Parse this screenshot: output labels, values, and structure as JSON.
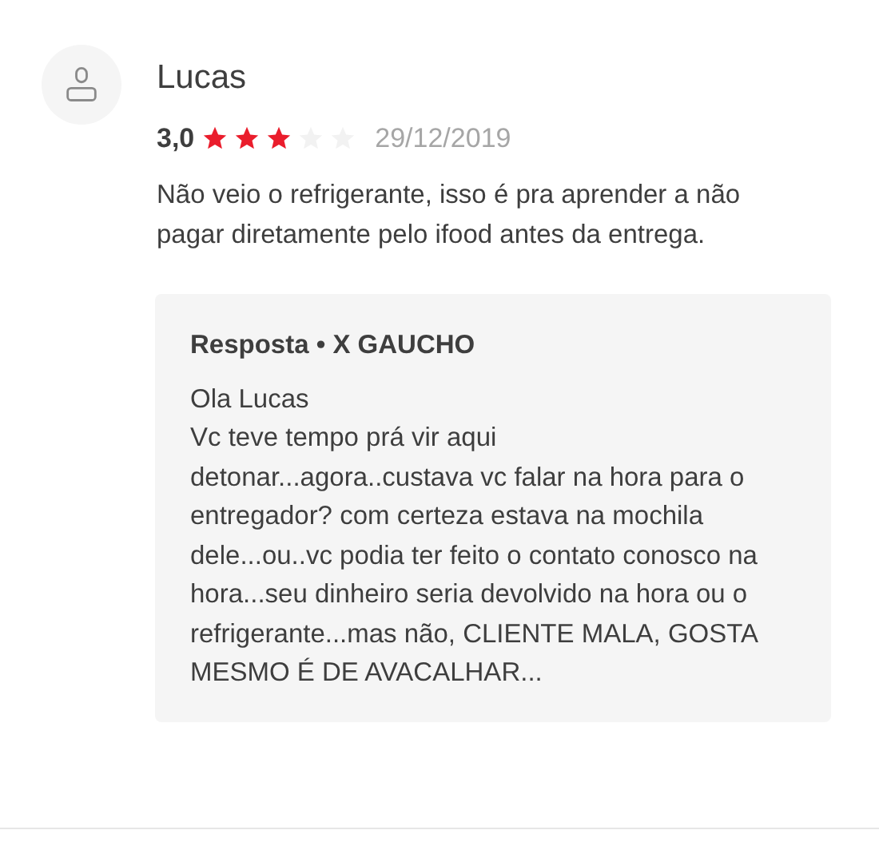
{
  "review": {
    "author": "Lucas",
    "rating": "3,0",
    "stars": 3,
    "date": "29/12/2019",
    "text": "Não veio o refrigerante, isso é pra aprender a não pagar diretamente pelo ifood antes da entrega."
  },
  "reply": {
    "heading": "Resposta • X GAUCHO",
    "paragraphs": [
      "Ola Lucas",
      "Vc teve tempo prá vir aqui detonar...agora..custava vc falar na hora para o entregador? com certeza estava na mochila dele...ou..vc podia ter feito o contato conosco na hora...seu dinheiro seria devolvido na hora ou o refrigerante...mas não, CLIENTE MALA, GOSTA MESMO É DE AVACALHAR..."
    ]
  }
}
